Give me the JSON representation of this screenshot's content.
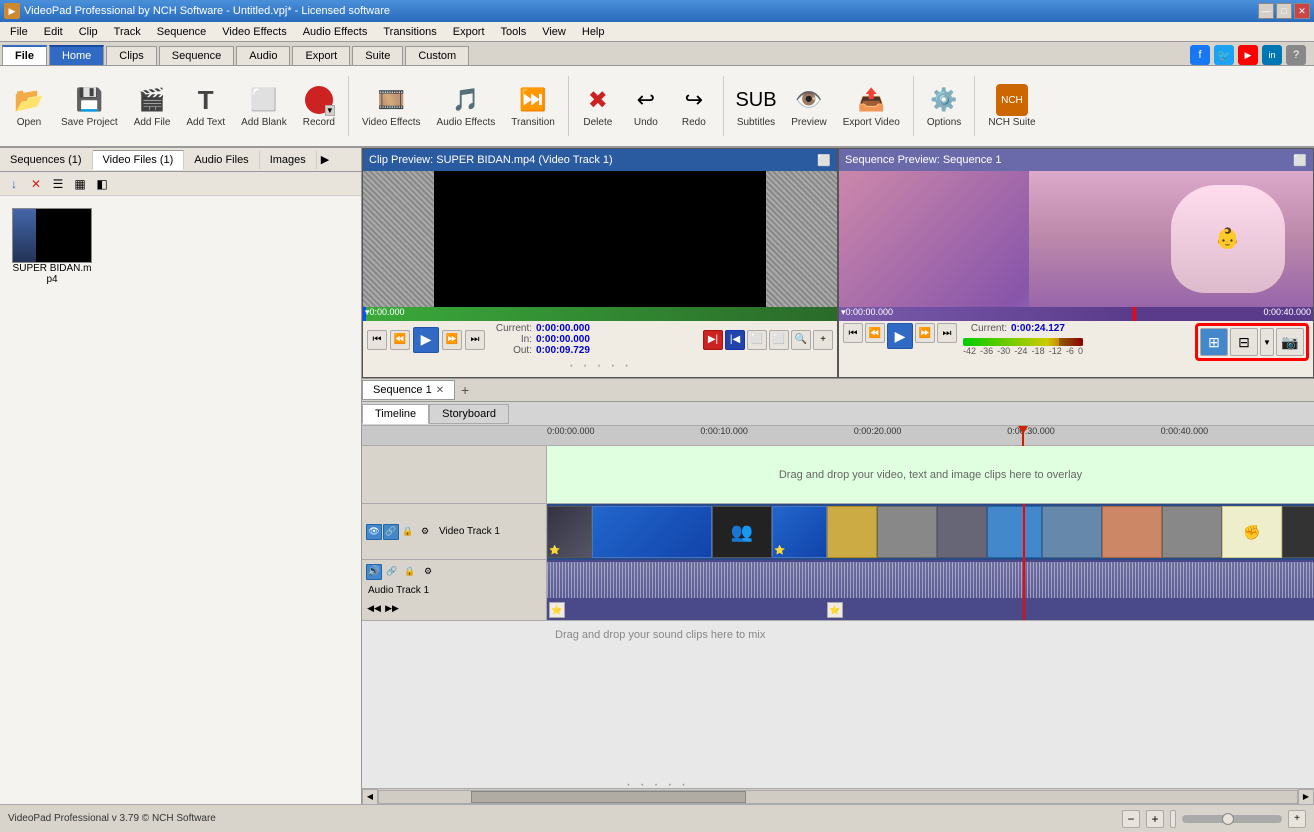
{
  "app": {
    "title": "VideoPad Professional by NCH Software - Untitled.vpj* - Licensed software"
  },
  "titlebar": {
    "title": "VideoPad Professional by NCH Software - Untitled.vpj* - Licensed software",
    "min_label": "—",
    "max_label": "□",
    "close_label": "✕"
  },
  "menubar": {
    "items": [
      "File",
      "Edit",
      "Clip",
      "Track",
      "Sequence",
      "Video Effects",
      "Audio Effects",
      "Transitions",
      "Export",
      "Tools",
      "View",
      "Help"
    ]
  },
  "ribbon_tabs": {
    "tabs": [
      "File",
      "Home",
      "Clips",
      "Sequence",
      "Audio",
      "Export",
      "Suite",
      "Custom"
    ],
    "active": "Home"
  },
  "ribbon": {
    "open_label": "Open",
    "save_label": "Save Project",
    "add_file_label": "Add File",
    "add_text_label": "Add Text",
    "add_blank_label": "Add Blank",
    "record_label": "Record",
    "video_effects_label": "Video Effects",
    "audio_effects_label": "Audio Effects",
    "transition_label": "Transition",
    "delete_label": "Delete",
    "undo_label": "Undo",
    "redo_label": "Redo",
    "subtitles_label": "Subtitles",
    "preview_label": "Preview",
    "export_video_label": "Export Video",
    "options_label": "Options",
    "nch_suite_label": "NCH Suite"
  },
  "lib_tabs": {
    "tabs": [
      "Sequences (1)",
      "Video Files (1)",
      "Audio Files",
      "Images"
    ],
    "active": "Video Files (1)"
  },
  "lib_toolbar": {
    "buttons": [
      "↓",
      "✕",
      "☰",
      "▤",
      "◫"
    ]
  },
  "media": {
    "files": [
      {
        "name": "SUPER BIDAN.mp4",
        "thumb_bg": "#1a1a1a"
      }
    ]
  },
  "clip_preview": {
    "title": "Clip Preview: SUPER BIDAN.mp4 (Video Track 1)",
    "current": "0:00:00.000",
    "in": "0:00:00.000",
    "out": "0:00:09.729"
  },
  "seq_preview": {
    "title": "Sequence Preview: Sequence 1",
    "current": "0:00:24.127"
  },
  "timeline": {
    "tabs": [
      "Timeline",
      "Storyboard"
    ],
    "active": "Timeline",
    "sequence_tab": "Sequence 1",
    "overlay_hint": "Drag and drop your video, text and image clips here to overlay",
    "audio_hint": "Drag and drop your sound clips here to mix",
    "video_track_label": "Video Track 1",
    "audio_track_label": "Audio Track 1",
    "ruler_marks": [
      "0:00:00.000",
      "0:00:10.000",
      "0:00:20.000",
      "0:00:30.000",
      "0:00:40.000"
    ],
    "ruler_marks_positions": [
      "0",
      "20%",
      "40%",
      "60%",
      "80%"
    ]
  },
  "bottom": {
    "status": "VideoPad Professional v 3.79 © NCH Software"
  },
  "colors": {
    "accent_blue": "#316ac5",
    "track_blue": "#3a6faa",
    "seq_purple": "#6a6aaa",
    "highlight_red": "#cc0000"
  }
}
